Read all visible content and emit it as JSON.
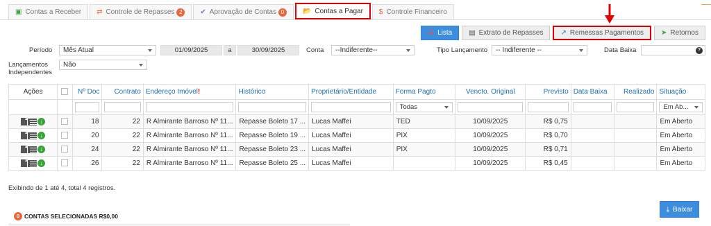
{
  "tabs": [
    {
      "label": "Contas a Receber",
      "icon": "money-icon",
      "color": "#3ba53b"
    },
    {
      "label": "Controle de Repasses",
      "icon": "swap-icon",
      "color": "#e8683e",
      "badge": "2"
    },
    {
      "label": "Aprovação de Contas",
      "icon": "check-icon",
      "color": "#8a6ad0",
      "badge": "0"
    },
    {
      "label": "Contas a Pagar",
      "icon": "folder-open-icon",
      "color": "#1f6fb5"
    },
    {
      "label": "Controle Financeiro",
      "icon": "dollar-icon",
      "color": "#e8683e"
    }
  ],
  "toolbar": {
    "lista": "Lista",
    "extrato": "Extrato de Repasses",
    "remessas": "Remessas Pagamentos",
    "retornos": "Retornos"
  },
  "filters": {
    "periodo_label": "Período",
    "periodo_value": "Mês Atual",
    "date_from": "01/09/2025",
    "date_sep": "a",
    "date_to": "30/09/2025",
    "conta_label": "Conta",
    "conta_value": "--Indiferente--",
    "tipo_label": "Tipo Lançamento",
    "tipo_value": "-- Indiferente --",
    "data_baixa_label": "Data Baixa",
    "data_baixa_help": "?",
    "independentes_label_1": "Lançamentos",
    "independentes_label_2": "Independentes",
    "independentes_value": "Não"
  },
  "table": {
    "headers": [
      "Ações",
      "",
      "Nº Doc",
      "Contrato",
      "Endereço Imóvel",
      "Histórico",
      "Proprietário/Entidade",
      "Forma Pagto",
      "Vencto. Original",
      "Previsto",
      "Data Baixa",
      "Realizado",
      "Situação"
    ],
    "endereco_required": "!",
    "forma_filter": "Todas",
    "situacao_filter": "Em Ab...",
    "rows": [
      {
        "doc": "18",
        "contrato": "22",
        "endereco": "R Almirante Barroso Nº 11...",
        "historico": "Repasse Boleto 17 ...",
        "proprietario": "Lucas Maffei",
        "forma": "TED",
        "vencto": "10/09/2025",
        "previsto": "R$ 0,75",
        "baixa": "",
        "realizado": "",
        "situacao": "Em Aberto"
      },
      {
        "doc": "20",
        "contrato": "22",
        "endereco": "R Almirante Barroso Nº 11...",
        "historico": "Repasse Boleto 19 ...",
        "proprietario": "Lucas Maffei",
        "forma": "PIX",
        "vencto": "10/09/2025",
        "previsto": "R$ 0,70",
        "baixa": "",
        "realizado": "",
        "situacao": "Em Aberto"
      },
      {
        "doc": "24",
        "contrato": "22",
        "endereco": "R Almirante Barroso Nº 11...",
        "historico": "Repasse Boleto 23 ...",
        "proprietario": "Lucas Maffei",
        "forma": "PIX",
        "vencto": "10/09/2025",
        "previsto": "R$ 0,71",
        "baixa": "",
        "realizado": "",
        "situacao": "Em Aberto"
      },
      {
        "doc": "26",
        "contrato": "22",
        "endereco": "R Almirante Barroso Nº 11...",
        "historico": "Repasse Boleto 25 ...",
        "proprietario": "Lucas Maffei",
        "forma": "",
        "vencto": "10/09/2025",
        "previsto": "R$ 0,45",
        "baixa": "",
        "realizado": "",
        "situacao": "Em Aberto"
      }
    ]
  },
  "footer": {
    "info": "Exibindo de 1 até 4, total 4 registros.",
    "selected_count": "0",
    "selected_label": "CONTAS SELECIONADAS R$0,00",
    "baixar": "Baixar"
  }
}
